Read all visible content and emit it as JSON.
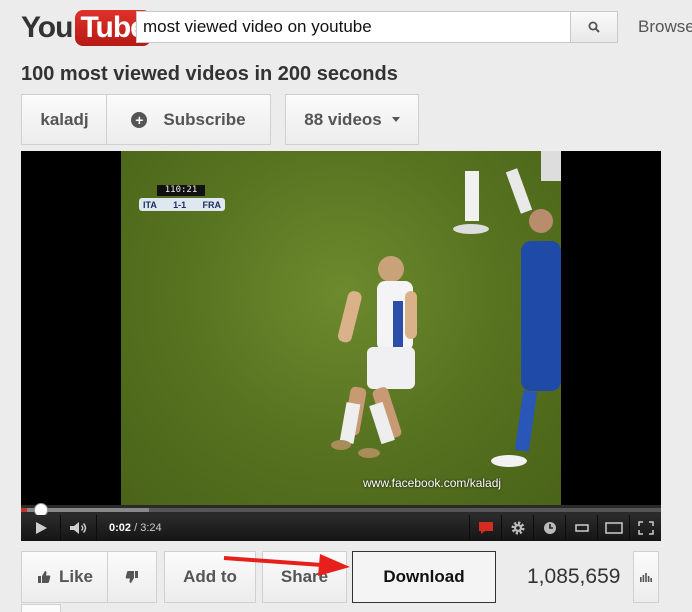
{
  "header": {
    "logo_you": "You",
    "logo_tube": "Tube",
    "search_value": "most viewed video on youtube",
    "browse_label": "Browse"
  },
  "video": {
    "title": "100 most viewed videos in 200 seconds",
    "channel": "kaladj",
    "subscribe_label": "Subscribe",
    "videos_count_label": "88 videos",
    "watermark": "www.facebook.com/kaladj",
    "scorebug": {
      "clock": "110:21",
      "team_home": "ITA",
      "score": "1-1",
      "team_away": "FRA"
    }
  },
  "player": {
    "current_time": "0:02",
    "separator": " / ",
    "duration": "3:24",
    "progress_fraction": 0.01,
    "loaded_fraction": 0.2
  },
  "actions": {
    "like_label": "Like",
    "add_to_label": "Add to",
    "share_label": "Share",
    "download_label": "Download",
    "view_count": "1,085,659"
  },
  "colors": {
    "youtube_red": "#c8241f",
    "progress_red": "#c4302b",
    "annotation_arrow": "#e8201c",
    "pitch_green": "#5b7623"
  }
}
